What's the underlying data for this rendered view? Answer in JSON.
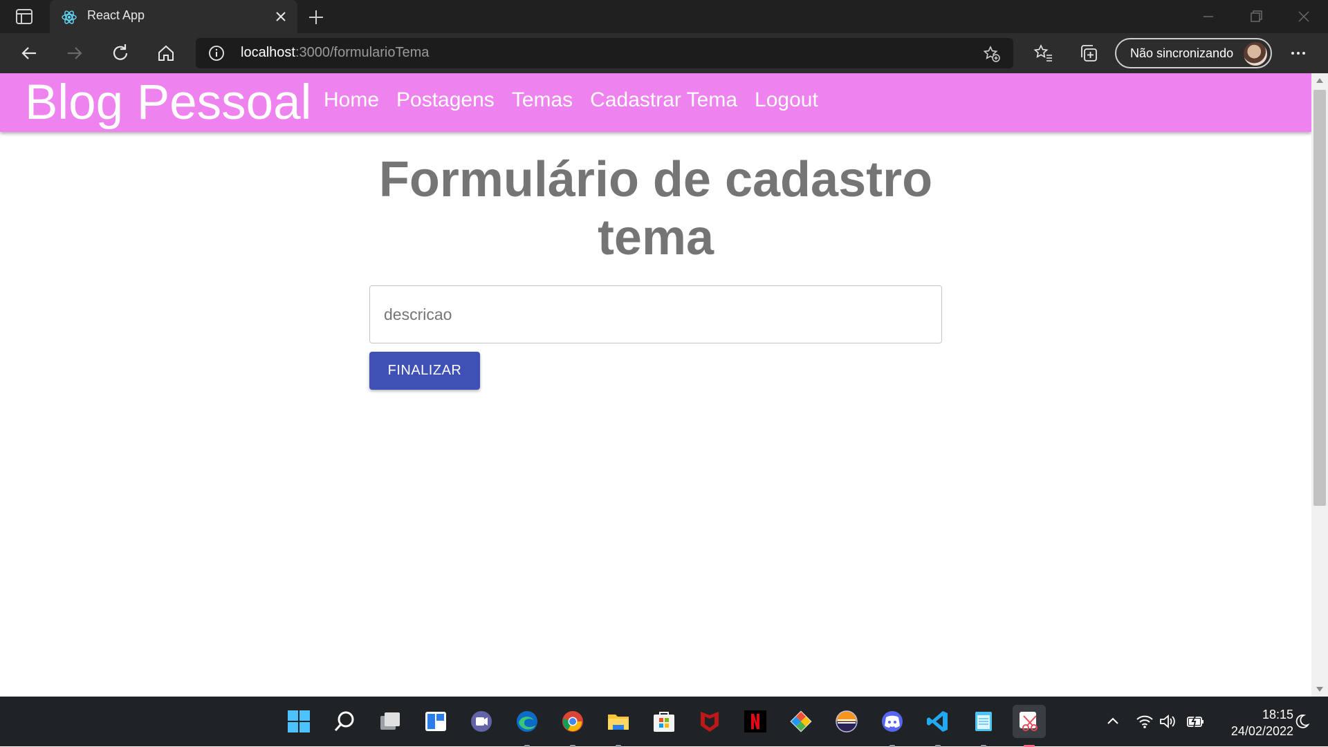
{
  "browser": {
    "tab_title": "React App",
    "url_host": "localhost",
    "url_path": ":3000/formularioTema",
    "profile_label": "Não sincronizando"
  },
  "app": {
    "brand": "Blog Pessoal",
    "nav": [
      "Home",
      "Postagens",
      "Temas",
      "Cadastrar Tema",
      "Logout"
    ]
  },
  "form": {
    "heading": "Formulário de cadastro tema",
    "description_placeholder": "descricao",
    "description_value": "",
    "submit_label": "FINALIZAR"
  },
  "taskbar": {
    "apps": [
      "start-icon",
      "search-icon",
      "task-view-icon",
      "widgets-icon",
      "teams-chat-icon",
      "edge-icon",
      "chrome-icon",
      "file-explorer-icon",
      "microsoft-store-icon",
      "mcafee-icon",
      "netflix-icon",
      "git-icon",
      "eclipse-icon",
      "discord-icon",
      "vscode-icon",
      "notepad-icon",
      "snipping-tool-icon"
    ],
    "time": "18:15",
    "date": "24/02/2022"
  },
  "colors": {
    "appbar": "#ee82ee",
    "button": "#3f51b5",
    "heading": "#757575"
  }
}
